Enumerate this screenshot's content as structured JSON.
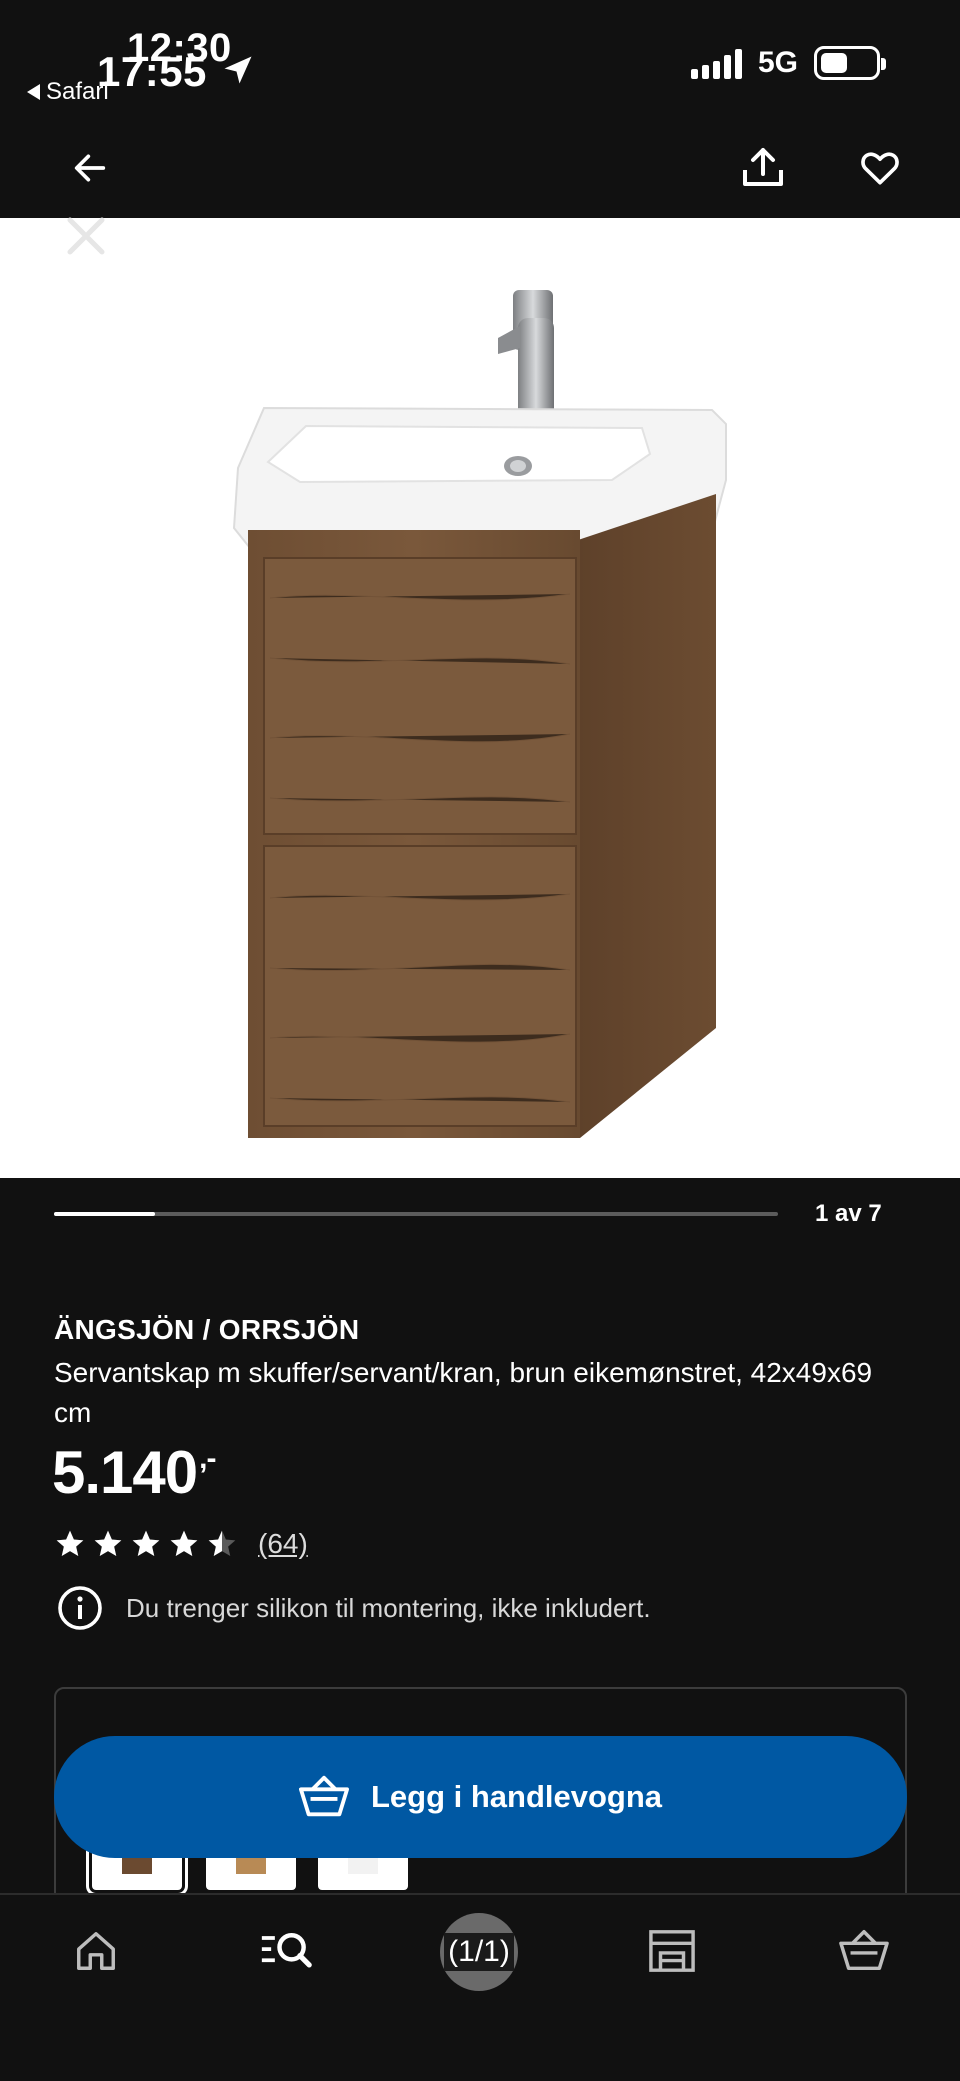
{
  "status_bar": {
    "time_overlay": "12:30",
    "time": "17:55",
    "back_app": "Safari",
    "network": "5G"
  },
  "header": {
    "back_icon": "arrow-left-icon",
    "share_icon": "share-icon",
    "favorite_icon": "heart-icon"
  },
  "image": {
    "close_icon": "close-icon",
    "progress_fraction": 0.14,
    "progress_label": "1 av 7"
  },
  "product": {
    "name": "ÄNGSJÖN / ORRSJÖN",
    "description": "Servantskap m skuffer/servant/kran, brun eikemønstret, 42x49x69 cm",
    "price": "5.140",
    "price_suffix": ",-",
    "rating": 4.5,
    "review_count": "(64)",
    "notice": "Du trenger silikon til montering, ikke inkludert."
  },
  "variants": [
    {
      "name": "brown-oak",
      "color": "#6b4a30",
      "selected": true
    },
    {
      "name": "light-oak",
      "color": "#b88a55",
      "selected": false
    },
    {
      "name": "white",
      "color": "#f2f2f2",
      "selected": false
    }
  ],
  "cart_button": {
    "label": "Legg i handlevogna",
    "color": "#0058a3"
  },
  "bottom_nav": {
    "items": [
      "home-icon",
      "search-icon",
      "store-icon",
      "cart-icon"
    ],
    "page_counter": "(1/1)"
  }
}
